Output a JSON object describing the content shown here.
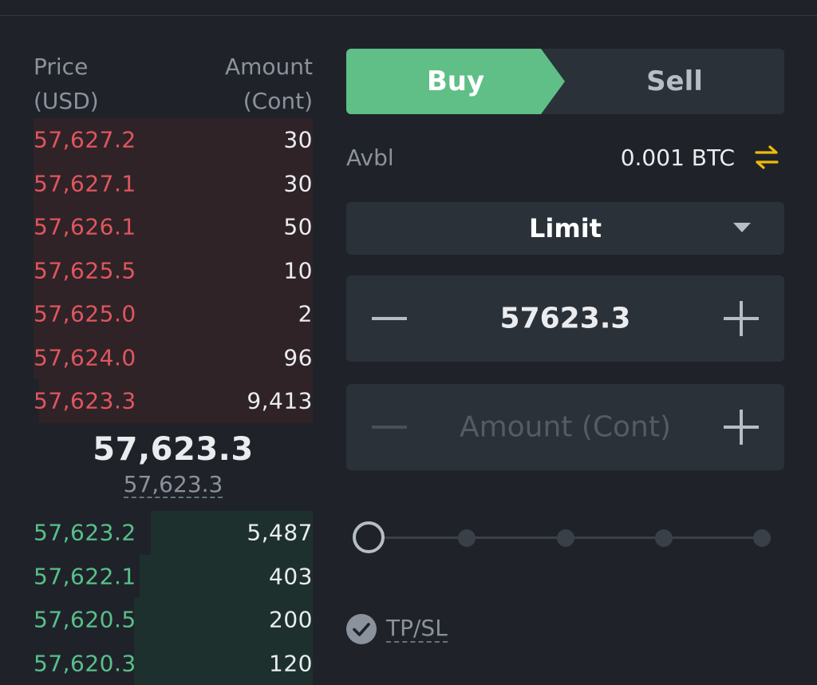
{
  "orderbook": {
    "headers": {
      "price": "Price\n(USD)",
      "amount": "Amount\n(Cont)"
    },
    "asks": [
      {
        "price": "57,627.2",
        "amount": "30",
        "depth_fraction": 1.0
      },
      {
        "price": "57,627.1",
        "amount": "30",
        "depth_fraction": 1.0
      },
      {
        "price": "57,626.1",
        "amount": "50",
        "depth_fraction": 1.0
      },
      {
        "price": "57,625.5",
        "amount": "10",
        "depth_fraction": 1.0
      },
      {
        "price": "57,625.0",
        "amount": "2",
        "depth_fraction": 1.0
      },
      {
        "price": "57,624.0",
        "amount": "96",
        "depth_fraction": 1.0
      },
      {
        "price": "57,623.3",
        "amount": "9,413",
        "depth_fraction": 0.98
      }
    ],
    "last_price": "57,623.3",
    "mark_price": "57,623.3",
    "bids": [
      {
        "price": "57,623.2",
        "amount": "5,487",
        "depth_fraction": 0.58
      },
      {
        "price": "57,622.1",
        "amount": "403",
        "depth_fraction": 0.62
      },
      {
        "price": "57,620.5",
        "amount": "200",
        "depth_fraction": 0.64
      },
      {
        "price": "57,620.3",
        "amount": "120",
        "depth_fraction": 0.64
      }
    ]
  },
  "form": {
    "buy_label": "Buy",
    "sell_label": "Sell",
    "avbl_label": "Avbl",
    "avbl_value": "0.001 BTC",
    "order_type": "Limit",
    "price_value": "57623.3",
    "amount_placeholder": "Amount (Cont)",
    "slider_percent": 0,
    "tpsl_label": "TP/SL"
  },
  "colors": {
    "background": "#1f2329",
    "panel": "#2b3139",
    "buy": "#5fbf87",
    "ask_text": "#e0565f",
    "bid_text": "#58c08b",
    "accent_icon": "#f0b90b"
  },
  "icons": {
    "transfer": "transfer-arrows-icon",
    "order_type_caret": "caret-down-icon",
    "tpsl_check": "check-circle-icon"
  }
}
